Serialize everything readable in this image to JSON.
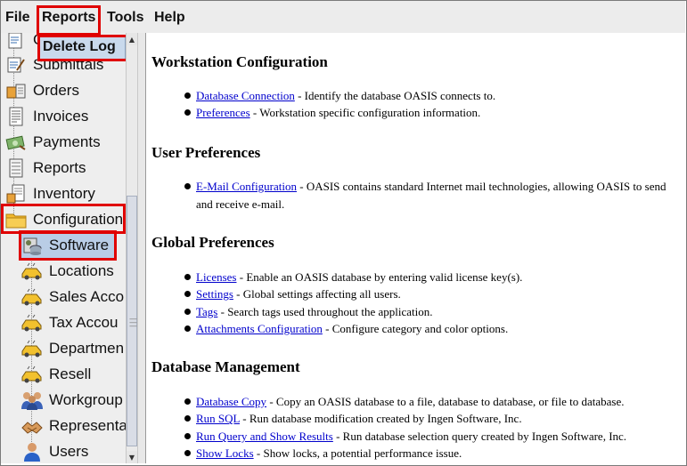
{
  "menubar": {
    "items": [
      "File",
      "Reports",
      "Tools",
      "Help"
    ]
  },
  "dropdown": {
    "item": "Delete Log"
  },
  "sidebar": {
    "items": [
      {
        "label": "C",
        "icon": "submittals-icon"
      },
      {
        "label": "Submittals",
        "icon": "submittals-icon"
      },
      {
        "label": "Orders",
        "icon": "orders-icon"
      },
      {
        "label": "Invoices",
        "icon": "invoices-icon"
      },
      {
        "label": "Payments",
        "icon": "payments-icon"
      },
      {
        "label": "Reports",
        "icon": "reports-icon"
      },
      {
        "label": "Inventory",
        "icon": "inventory-icon"
      },
      {
        "label": "Configuration",
        "icon": "folder-icon"
      },
      {
        "label": "Software",
        "icon": "software-icon"
      },
      {
        "label": "Locations",
        "icon": "car-icon"
      },
      {
        "label": "Sales Acco",
        "icon": "car-icon"
      },
      {
        "label": "Tax Accou",
        "icon": "car-icon"
      },
      {
        "label": "Departmen",
        "icon": "car-icon"
      },
      {
        "label": "Resell",
        "icon": "car-icon"
      },
      {
        "label": "Workgroup",
        "icon": "workgroup-icon"
      },
      {
        "label": "Representa",
        "icon": "representative-icon"
      },
      {
        "label": "Users",
        "icon": "user-icon"
      }
    ]
  },
  "content": {
    "sections": [
      {
        "title": "Workstation Configuration",
        "items": [
          {
            "link": "Database Connection",
            "text": " - Identify the database OASIS connects to."
          },
          {
            "link": "Preferences",
            "text": " - Workstation specific configuration information."
          }
        ]
      },
      {
        "title": "User Preferences",
        "items": [
          {
            "link": "E-Mail Configuration",
            "text": " - OASIS contains standard Internet mail technologies, allowing OASIS to send and receive e-mail."
          }
        ]
      },
      {
        "title": "Global Preferences",
        "items": [
          {
            "link": "Licenses",
            "text": " - Enable an OASIS database by entering valid license key(s)."
          },
          {
            "link": "Settings",
            "text": " - Global settings affecting all users."
          },
          {
            "link": "Tags",
            "text": " - Search tags used throughout the application."
          },
          {
            "link": "Attachments Configuration",
            "text": " - Configure category and color options."
          }
        ]
      },
      {
        "title": "Database Management",
        "items": [
          {
            "link": "Database Copy",
            "text": " - Copy an OASIS database to a file, database to database, or file to database."
          },
          {
            "link": "Run SQL",
            "text": " - Run database modification created by Ingen Software, Inc."
          },
          {
            "link": "Run Query and Show Results",
            "text": " - Run database selection query created by Ingen Software, Inc."
          },
          {
            "link": "Show Locks",
            "text": " - Show locks, a potential performance issue."
          }
        ]
      }
    ]
  },
  "colors": {
    "highlight": "#e00000",
    "link": "#0000cc",
    "selection": "#b9cde6"
  }
}
